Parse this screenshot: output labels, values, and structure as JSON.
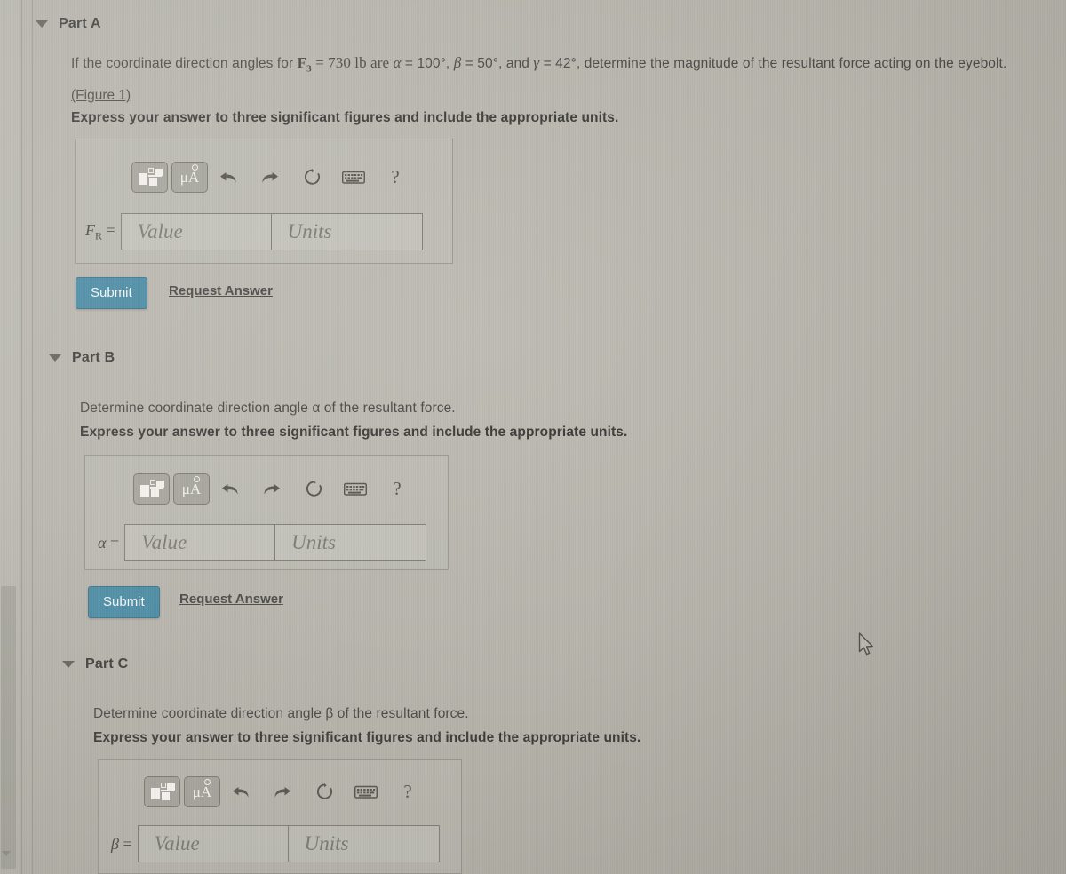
{
  "page": {
    "background_color": "#b6b4ab",
    "text_color": "#4b4a46",
    "accent_color": "#4b8ba3"
  },
  "parts": [
    {
      "id": "part-a",
      "title": "Part A",
      "prompt_prefix": "If the coordinate direction angles for ",
      "force_symbol": "F",
      "force_subscript": "3",
      "force_value": " = 730 lb are ",
      "alpha_symbol": "α",
      "alpha_value": " = 100°, ",
      "beta_symbol": "β",
      "beta_value": " = 50°, and ",
      "gamma_symbol": "γ",
      "gamma_value": " = 42°, determine the magnitude of the resultant force acting on the eyebolt.",
      "figure_link": "(Figure 1)",
      "instruction": "Express your answer to three significant figures and include the appropriate units.",
      "variable_label": "F",
      "variable_subscript": "R",
      "variable_equals": " =",
      "value_placeholder": "Value",
      "units_placeholder": "Units",
      "submit_label": "Submit",
      "request_answer_label": "Request Answer"
    },
    {
      "id": "part-b",
      "title": "Part B",
      "prompt": "Determine coordinate direction angle α of the resultant force.",
      "instruction": "Express your answer to three significant figures and include the appropriate units.",
      "variable_label": "α",
      "variable_equals": " =",
      "value_placeholder": "Value",
      "units_placeholder": "Units",
      "submit_label": "Submit",
      "request_answer_label": "Request Answer"
    },
    {
      "id": "part-c",
      "title": "Part C",
      "prompt": "Determine coordinate direction angle β of the resultant force.",
      "instruction": "Express your answer to three significant figures and include the appropriate units.",
      "variable_label": "β",
      "variable_equals": " =",
      "value_placeholder": "Value",
      "units_placeholder": "Units"
    }
  ],
  "toolbar": {
    "template_icon": "math-template-icon",
    "units_icon": "μA",
    "undo_icon": "undo-icon",
    "redo_icon": "redo-icon",
    "reset_icon": "reset-icon",
    "keyboard_icon": "keyboard-icon",
    "help_icon": "?"
  }
}
